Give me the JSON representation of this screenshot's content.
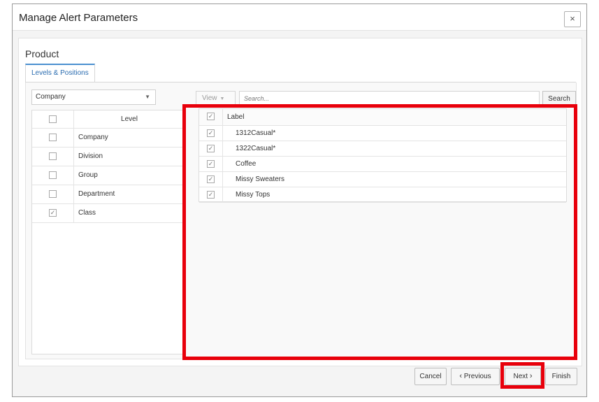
{
  "dialog": {
    "title": "Manage Alert Parameters",
    "close_glyph": "×"
  },
  "product": {
    "title": "Product",
    "tab_label": "Levels & Positions",
    "dropdown_value": "Company",
    "level_header": "Level",
    "levels": [
      {
        "label": "Company",
        "checked": false
      },
      {
        "label": "Division",
        "checked": false
      },
      {
        "label": "Group",
        "checked": false
      },
      {
        "label": "Department",
        "checked": false
      },
      {
        "label": "Class",
        "checked": true
      }
    ]
  },
  "toolbar": {
    "view_label": "View",
    "search_placeholder": "Search...",
    "search_label": "Search"
  },
  "labels": {
    "header": "Label",
    "items": [
      {
        "label": "1312Casual*",
        "checked": true
      },
      {
        "label": "1322Casual*",
        "checked": true
      },
      {
        "label": "Coffee",
        "checked": true
      },
      {
        "label": "Missy Sweaters",
        "checked": true
      },
      {
        "label": "Missy Tops",
        "checked": true
      }
    ]
  },
  "footer": {
    "cancel": "Cancel",
    "previous": "Previous",
    "next": "Next",
    "finish": "Finish"
  },
  "colors": {
    "highlight": "#e8000b",
    "accent": "#2a6cb0"
  }
}
